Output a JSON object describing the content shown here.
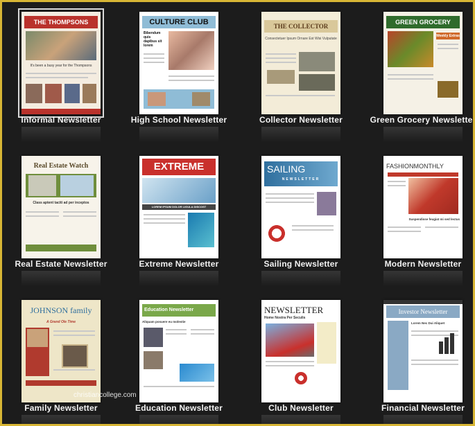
{
  "templates": [
    {
      "label": "Informal Newsletter",
      "masthead": "THE THOMPSONS",
      "headline": "It's been a busy year for the Thompsons",
      "accent": "#b9322b"
    },
    {
      "label": "High School Newsletter",
      "masthead": "CULTURE CLUB",
      "headline": "Bibendum quis dapibus sit lorem",
      "accent": "#8fbcd6"
    },
    {
      "label": "Collector Newsletter",
      "masthead": "THE COLLECTOR",
      "headline": "Consectetuer Ipsum Ornare Est Wisi Vulputate",
      "accent": "#d9c89a"
    },
    {
      "label": "Green Grocery Newsletter",
      "masthead": "GREEN GROCERY",
      "headline": "Weekly Extras",
      "accent": "#2f6b2c"
    },
    {
      "label": "Real Estate Newsletter",
      "masthead": "Real Estate Watch",
      "headline": "Class aptent taciti ad per inceptos",
      "accent": "#6f8e3c"
    },
    {
      "label": "Extreme Newsletter",
      "masthead": "EXTREME",
      "headline": "LOREM IPSUM DOLOR LIGULA DISCOST",
      "accent": "#c9302c"
    },
    {
      "label": "Sailing Newsletter",
      "masthead": "SAILING",
      "headline": "NEWSLETTER",
      "accent": "#2f6f9e"
    },
    {
      "label": "Modern Newsletter",
      "masthead": "FASHIONMONTHLY",
      "headline": "Suspendisse feugiat mi sed lectus",
      "accent": "#c0392b"
    },
    {
      "label": "Family Newsletter",
      "masthead": "JOHNSON family",
      "headline": "A Grand Ole Time",
      "accent": "#b03a2e"
    },
    {
      "label": "Education Newsletter",
      "masthead": "Education Newsletter",
      "headline": "Aliquam posuere eu molestie",
      "accent": "#7aa84a"
    },
    {
      "label": "Club Newsletter",
      "masthead": "NEWSLETTER",
      "headline": "Home Nostra Per Seculis",
      "accent": "#333333"
    },
    {
      "label": "Financial Newsletter",
      "masthead": "Investor Newsletter",
      "headline": "Lorem Nec Dui Aliquet",
      "accent": "#8aa9c4"
    }
  ],
  "watermark": "christiancollege.com"
}
